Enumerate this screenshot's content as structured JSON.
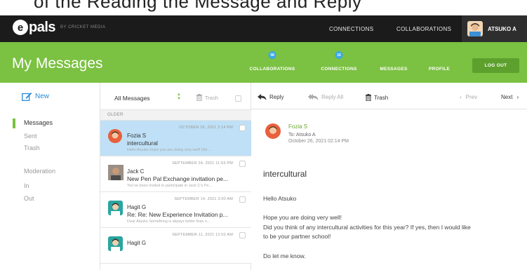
{
  "caption": "of the Reading the Message and Reply",
  "brand": {
    "name": "epals",
    "sub": "BY CRICKET MEDIA"
  },
  "topnav": {
    "connections": "CONNECTIONS",
    "collaborations": "COLLABORATIONS"
  },
  "user": {
    "name": "ATSUKO A"
  },
  "header": {
    "title": "My Messages",
    "nav": {
      "collaborations": {
        "label": "COLLABORATIONS",
        "badge": "58"
      },
      "connections": {
        "label": "CONNECTIONS",
        "badge": "16"
      },
      "messages": {
        "label": "MESSAGES"
      },
      "profile": {
        "label": "PROFILE"
      }
    },
    "logout": "LOG OUT"
  },
  "sidebar": {
    "new": "New",
    "items": [
      "Messages",
      "Sent",
      "Trash",
      "Moderation",
      "In",
      "Out"
    ]
  },
  "list": {
    "filter": "All Messages",
    "trash": "Trash",
    "section": "OLDER",
    "messages": [
      {
        "date": "OCTOBER 26, 2021 2:14 PM",
        "name": "Fozia S",
        "subject": "intercultural",
        "preview": "Hello Atsuko Hope you are doing very well! Did ..."
      },
      {
        "date": "SEPTEMBER 24, 2021 11:53 PM",
        "name": "Jack C",
        "subject": "New Pen Pal Exchange invitation pe...",
        "preview": "You've been invited to participate in Jack C's Pe..."
      },
      {
        "date": "SEPTEMBER 14, 2021 3:00 AM",
        "name": "Hagit G",
        "subject": "Re: Re: New Experience Invitation p...",
        "preview": "Dear Atsuko Something is always better than n..."
      },
      {
        "date": "SEPTEMBER 11, 2021 12:02 AM",
        "name": "Hagit G",
        "subject": "",
        "preview": ""
      }
    ]
  },
  "reader": {
    "toolbar": {
      "reply": "Reply",
      "reply_all": "Reply All",
      "trash": "Trash",
      "prev": "Prev",
      "next": "Next"
    },
    "from": "Fozia S",
    "to": "To: Atsuko A",
    "date": "October 26, 2021 02:14 PM",
    "subject": "intercultural",
    "body": [
      "Hello Atsuko",
      "Hope you are doing very well!",
      "Did you think of any intercultural activities for this year? If yes, then I would like",
      "to be your partner school!",
      "Do let me know."
    ]
  },
  "colors": {
    "green": "#7bc142",
    "dark": "#1b1b1b",
    "selected": "#bfe0f6",
    "link": "#2a8ad4"
  }
}
